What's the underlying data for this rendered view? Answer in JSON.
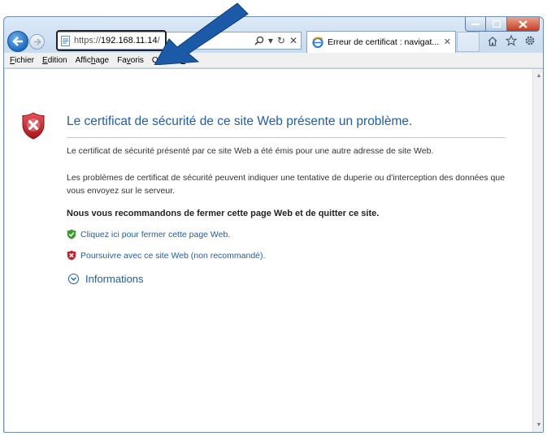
{
  "browser": {
    "url_prefix": "https://",
    "url_host": "192.168.11.14",
    "url_suffix": "/",
    "search_icon": "search-icon",
    "dropdown_glyph": "▾",
    "refresh_glyph": "↻",
    "stop_glyph": "✕",
    "tab_title": "Erreur de certificat : navigat...",
    "tab_close": "✕"
  },
  "menu": {
    "items": [
      {
        "before": "",
        "key": "F",
        "after": "ichier"
      },
      {
        "before": "",
        "key": "E",
        "after": "dition"
      },
      {
        "before": "Affic",
        "key": "h",
        "after": "age"
      },
      {
        "before": "Fa",
        "key": "v",
        "after": "oris"
      },
      {
        "before": "O",
        "key": "u",
        "after": "tils"
      },
      {
        "before": "",
        "key": "?",
        "after": ""
      }
    ]
  },
  "page": {
    "title": "Le certificat de sécurité de ce site Web présente un problème.",
    "paragraph1": "Le certificat de sécurité présenté par ce site Web a été émis pour une autre adresse de site Web.",
    "paragraph2": "Les problèmes de certificat de sécurité peuvent indiquer une tentative de duperie ou d'interception des données que vous envoyez sur le serveur.",
    "recommendation": "Nous vous recommandons de fermer cette page Web et de quitter ce site.",
    "link_close": "Cliquez ici pour fermer cette page Web.",
    "link_continue": "Poursuivre avec ce site Web (non recommandé).",
    "info_label": "Informations"
  },
  "colors": {
    "accent_link": "#1f5ea8",
    "shield_red": "#c8202a",
    "shield_green": "#3c9a2f",
    "arrow_blue": "#1a5aa6"
  }
}
